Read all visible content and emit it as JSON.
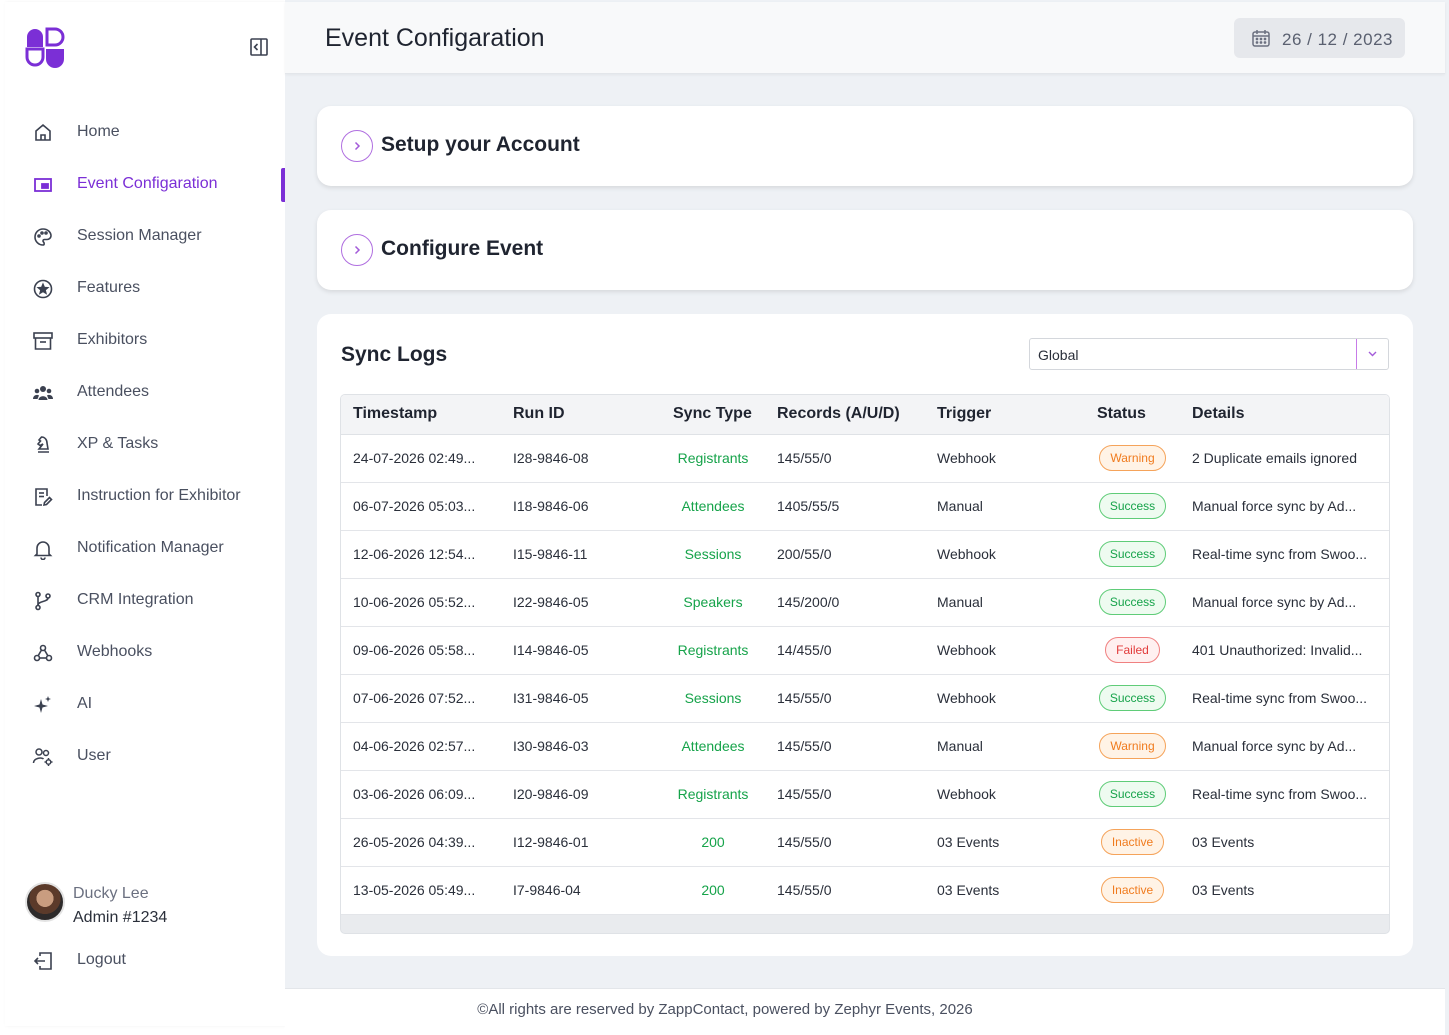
{
  "sidebar": {
    "items": [
      {
        "label": "Home",
        "icon": "home-icon",
        "active": false
      },
      {
        "label": "Event Configaration",
        "icon": "event-config-icon",
        "active": true
      },
      {
        "label": "Session Manager",
        "icon": "palette-icon",
        "active": false
      },
      {
        "label": "Features",
        "icon": "star-circle-icon",
        "active": false
      },
      {
        "label": "Exhibitors",
        "icon": "archive-icon",
        "active": false
      },
      {
        "label": "Attendees",
        "icon": "people-icon",
        "active": false
      },
      {
        "label": "XP & Tasks",
        "icon": "chess-knight-icon",
        "active": false
      },
      {
        "label": "Instruction for Exhibitor",
        "icon": "document-edit-icon",
        "active": false
      },
      {
        "label": "Notification Manager",
        "icon": "bell-icon",
        "active": false
      },
      {
        "label": "CRM Integration",
        "icon": "git-branch-icon",
        "active": false
      },
      {
        "label": "Webhooks",
        "icon": "webhook-icon",
        "active": false
      },
      {
        "label": "AI",
        "icon": "sparkle-icon",
        "active": false
      },
      {
        "label": "User",
        "icon": "users-gear-icon",
        "active": false
      }
    ],
    "profile": {
      "name": "Ducky Lee",
      "role": "Admin #1234"
    },
    "logout_label": "Logout"
  },
  "header": {
    "title": "Event Configaration",
    "date": "26 / 12 / 2023"
  },
  "accordions": [
    {
      "title": "Setup your Account"
    },
    {
      "title": "Configure Event"
    }
  ],
  "sync_logs": {
    "title": "Sync Logs",
    "filter_value": "Global",
    "columns": [
      "Timestamp",
      "Run ID",
      "Sync Type",
      "Records (A/U/D)",
      "Trigger",
      "Status",
      "Details"
    ],
    "rows": [
      {
        "timestamp": "24-07-2026 02:49...",
        "run_id": "I28-9846-08",
        "sync_type": "Registrants",
        "records": "145/55/0",
        "trigger": "Webhook",
        "status": "Warning",
        "details": "2 Duplicate emails ignored"
      },
      {
        "timestamp": "06-07-2026 05:03...",
        "run_id": "I18-9846-06",
        "sync_type": "Attendees",
        "records": "1405/55/5",
        "trigger": "Manual",
        "status": "Success",
        "details": "Manual force sync by Ad..."
      },
      {
        "timestamp": "12-06-2026 12:54...",
        "run_id": "I15-9846-11",
        "sync_type": "Sessions",
        "records": "200/55/0",
        "trigger": "Webhook",
        "status": "Success",
        "details": "Real-time sync from Swoo..."
      },
      {
        "timestamp": "10-06-2026 05:52...",
        "run_id": "I22-9846-05",
        "sync_type": "Speakers",
        "records": "145/200/0",
        "trigger": "Manual",
        "status": "Success",
        "details": "Manual force sync by Ad..."
      },
      {
        "timestamp": "09-06-2026 05:58...",
        "run_id": "I14-9846-05",
        "sync_type": "Registrants",
        "records": "14/455/0",
        "trigger": "Webhook",
        "status": "Failed",
        "details": "401 Unauthorized: Invalid..."
      },
      {
        "timestamp": "07-06-2026 07:52...",
        "run_id": "I31-9846-05",
        "sync_type": "Sessions",
        "records": "145/55/0",
        "trigger": "Webhook",
        "status": "Success",
        "details": "Real-time sync from Swoo..."
      },
      {
        "timestamp": "04-06-2026 02:57...",
        "run_id": "I30-9846-03",
        "sync_type": "Attendees",
        "records": "145/55/0",
        "trigger": "Manual",
        "status": "Warning",
        "details": "Manual force sync by Ad..."
      },
      {
        "timestamp": "03-06-2026 06:09...",
        "run_id": "I20-9846-09",
        "sync_type": "Registrants",
        "records": "145/55/0",
        "trigger": "Webhook",
        "status": "Success",
        "details": "Real-time sync from Swoo..."
      },
      {
        "timestamp": "26-05-2026 04:39...",
        "run_id": "I12-9846-01",
        "sync_type": "200",
        "records": "145/55/0",
        "trigger": "03 Events",
        "status": "Inactive",
        "details": "03 Events"
      },
      {
        "timestamp": "13-05-2026 05:49...",
        "run_id": "I7-9846-04",
        "sync_type": "200",
        "records": "145/55/0",
        "trigger": "03 Events",
        "status": "Inactive",
        "details": "03 Events"
      }
    ]
  },
  "footer": {
    "text": "©All rights are reserved by ZappContact, powered by Zephyr Events, 2026"
  },
  "colors": {
    "accent": "#7b2fd6",
    "success": "#16a34a",
    "warning": "#f07b1e",
    "failed": "#e23b3b"
  }
}
